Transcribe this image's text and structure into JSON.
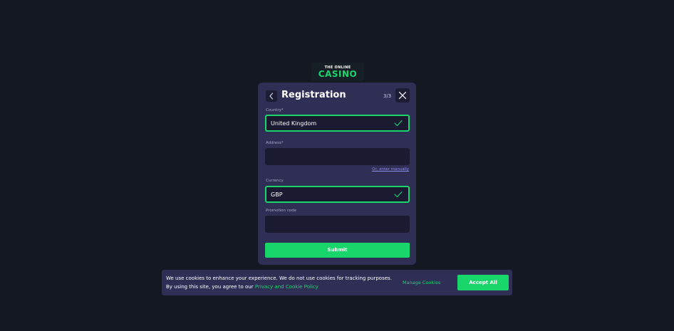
{
  "logo": {
    "top_text": "THE ONLINE",
    "main_text": "CASINO",
    "accent_color": "#19d66a"
  },
  "modal": {
    "title": "Registration",
    "step": "3/3",
    "back_icon": "chevron-left-icon",
    "close_icon": "close-icon",
    "fields": {
      "country": {
        "label": "Country*",
        "value": "United Kingdom",
        "valid": true
      },
      "address": {
        "label": "Address*",
        "value": "",
        "valid": false
      },
      "currency": {
        "label": "Currency",
        "value": "GBP",
        "valid": true
      },
      "promotion": {
        "label": "Promotion code",
        "value": "",
        "valid": false
      }
    },
    "manual_link": "Or, enter manually",
    "submit_label": "Submit"
  },
  "cookie": {
    "text": "We use cookies to enhance your experience. We do not use cookies for tracking purposes. By using this site, you agree to our ",
    "link": "Privacy and Cookie Policy",
    "manage_label": "Manage Cookies",
    "accept_label": "Accept All"
  },
  "colors": {
    "background": "#141823",
    "panel": "#2f2f55",
    "input": "#1a1a30",
    "accent": "#19d66a"
  }
}
